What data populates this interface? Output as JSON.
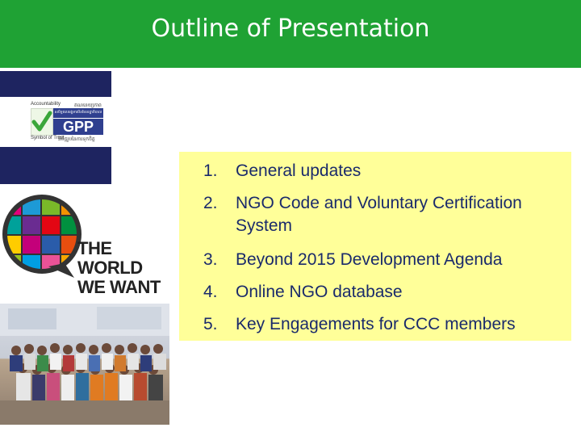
{
  "slide": {
    "title": "Outline of Presentation"
  },
  "gpp_badge": {
    "top_left": "Accountability",
    "top_right": "គណនេយ្យភាព",
    "strip_text": "សមិទ្ធផលអង្គការមិនមែនរដ្ឋាភិបាល",
    "word": "GPP",
    "bottom_left": "Symbol of Trust",
    "bottom_right": "និមិត្តរូបនៃការទុកចិត្ត"
  },
  "world_we_want": {
    "line1": "THE",
    "line2": "WORLD",
    "line3": "WE WANT"
  },
  "agenda": {
    "items": [
      {
        "num": "1.",
        "text": "General updates"
      },
      {
        "num": "2.",
        "text": "NGO Code and Voluntary Certification System"
      },
      {
        "num": "3.",
        "text": "Beyond 2015 Development Agenda"
      },
      {
        "num": "4.",
        "text": "Online NGO database"
      },
      {
        "num": "5.",
        "text": "Key Engagements for CCC members"
      }
    ]
  },
  "colors": {
    "header": "#1fa234",
    "navy": "#1e2460",
    "agenda_bg": "#ffff99",
    "agenda_text": "#1a2a6b"
  }
}
